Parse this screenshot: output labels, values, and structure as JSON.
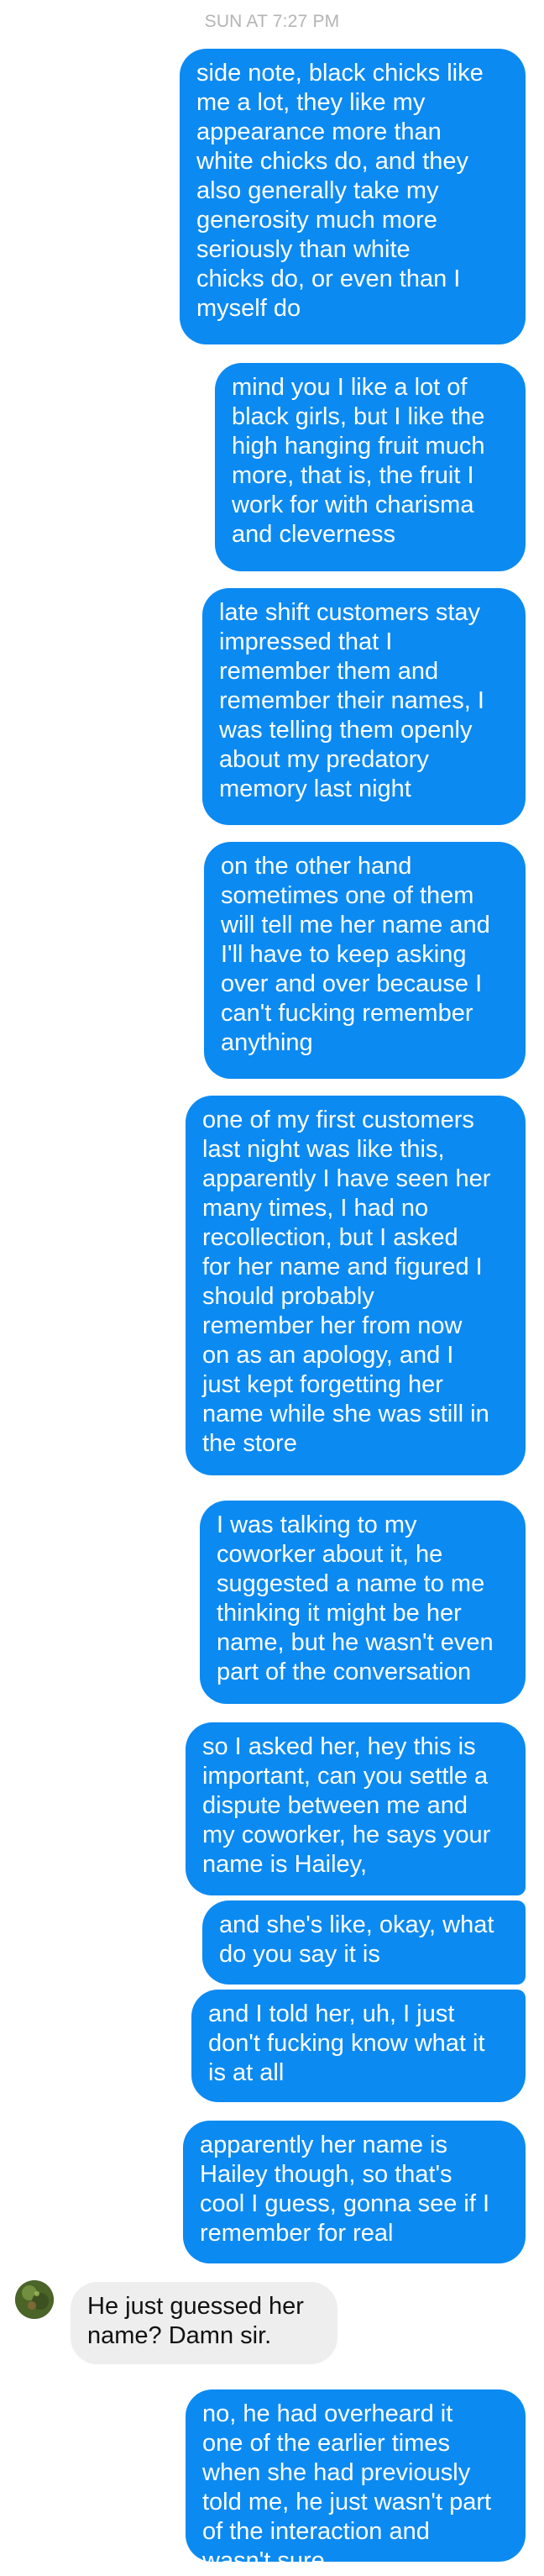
{
  "thread": {
    "timestamp": "SUN AT 7:27 PM",
    "messages": [
      {
        "from": "me",
        "text": "side note, black chicks like\nme a lot, they like my\nappearance more than\nwhite chicks do, and they\nalso generally take my\ngenerosity much more\nseriously than white\nchicks do, or even than I\nmyself do"
      },
      {
        "from": "me",
        "text": "mind you I like a lot of\nblack girls, but I like the\nhigh hanging fruit much\nmore, that is, the fruit I\nwork for with charisma\nand cleverness"
      },
      {
        "from": "me",
        "text": "late shift customers stay\nimpressed that I\nremember them and\nremember their names, I\nwas telling them openly\nabout my predatory\nmemory last night"
      },
      {
        "from": "me",
        "text": "on the other hand\nsometimes one of them\nwill tell me her name and\nI'll have to keep asking\nover and over because I\ncan't fucking remember\nanything"
      },
      {
        "from": "me",
        "text": "one of my first customers\nlast night was like this,\napparently I have seen her\nmany times, I had no\nrecollection, but I asked\nfor her name and figured I\nshould probably\nremember her from now\non as an apology, and I\njust kept forgetting her\nname while she was still in\nthe store"
      },
      {
        "from": "me",
        "text": "I was talking to my\ncoworker about it, he\nsuggested a name to me\nthinking it might be her\nname, but he wasn't even\npart of the conversation"
      },
      {
        "from": "me",
        "text": "so I asked her, hey this is\nimportant, can you settle a\ndispute between me and\nmy coworker, he says your\nname is Hailey,"
      },
      {
        "from": "me",
        "text": "and she's like, okay, what\ndo you say it is"
      },
      {
        "from": "me",
        "text": "and I told her, uh, I just\ndon't fucking know what it\nis at all"
      },
      {
        "from": "me",
        "text": "apparently her name is\nHailey though, so that's\ncool I guess, gonna see if I\nremember for real"
      },
      {
        "from": "them",
        "text": "He just guessed her\nname? Damn sir."
      },
      {
        "from": "me",
        "text": "no, he had overheard it\none of the earlier times\nwhen she had previously\ntold me, he just wasn't part\nof the interaction and\nwasn't sure"
      }
    ]
  },
  "colors": {
    "outgoing_bubble": "#0b8af2",
    "incoming_bubble": "#eeeeee",
    "timestamp": "#b4b4b4"
  },
  "icons": {
    "sender_avatar": "contact-avatar-icon"
  }
}
